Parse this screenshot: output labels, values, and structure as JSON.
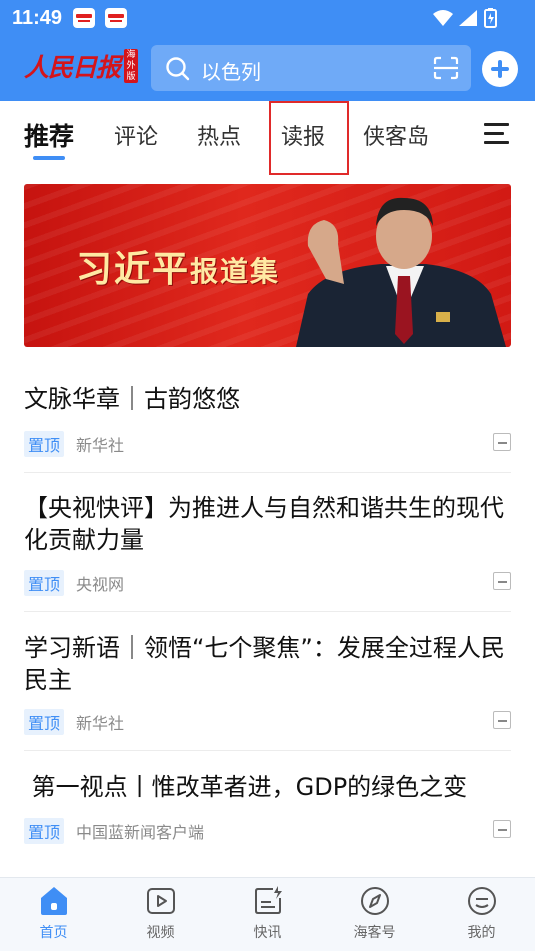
{
  "status_bar": {
    "time": "11:49"
  },
  "header": {
    "logo_text": "人民日报",
    "logo_badge": "海外版",
    "search_placeholder": "以色列"
  },
  "tabs": [
    {
      "label": "推荐",
      "active": true
    },
    {
      "label": "评论"
    },
    {
      "label": "热点"
    },
    {
      "label": "读报",
      "highlighted": true
    },
    {
      "label": "侠客岛"
    }
  ],
  "banner": {
    "title_part1": "习近平",
    "title_part2": "报道集"
  },
  "articles": [
    {
      "title": "文脉华章｜古韵悠悠",
      "tag": "置顶",
      "source": "新华社"
    },
    {
      "title": "【央视快评】为推进人与自然和谐共生的现代化贡献力量",
      "tag": "置顶",
      "source": "央视网"
    },
    {
      "title": "学习新语｜领悟“七个聚焦”：发展全过程人民民主",
      "tag": "置顶",
      "source": "新华社"
    },
    {
      "title": " 第一视点丨惟改革者进，GDP的绿色之变",
      "tag": "置顶",
      "source": "中国蓝新闻客户端"
    }
  ],
  "bottom_nav": [
    {
      "label": "首页",
      "icon": "home-icon",
      "active": true
    },
    {
      "label": "视频",
      "icon": "video-icon"
    },
    {
      "label": "快讯",
      "icon": "flash-news-icon"
    },
    {
      "label": "海客号",
      "icon": "compass-icon"
    },
    {
      "label": "我的",
      "icon": "profile-icon"
    }
  ],
  "colors": {
    "primary": "#3f8ef5",
    "brand_red": "#d4141b",
    "highlight": "#e02a2a"
  }
}
